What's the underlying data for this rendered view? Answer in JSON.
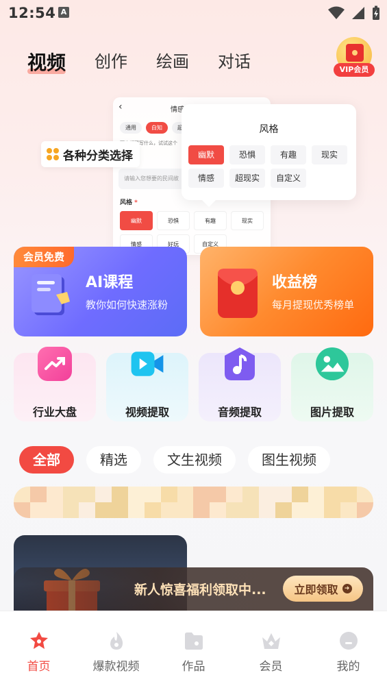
{
  "status_bar": {
    "time": "12:54",
    "notification_letter": "A"
  },
  "top_tabs": [
    {
      "label": "视频",
      "active": true
    },
    {
      "label": "创作",
      "active": false
    },
    {
      "label": "绘画",
      "active": false
    },
    {
      "label": "对话",
      "active": false
    }
  ],
  "vip_badge": {
    "label": "VIP会员"
  },
  "banner": {
    "float_label": "各种分类选择",
    "bg_card": {
      "title": "情感",
      "chips": [
        "通用",
        "白知",
        "超"
      ],
      "hint": "下次都要写什么，试试这个",
      "input_placeholder": "请输入您想要的民间故",
      "style_label": "风格",
      "style_required": "*",
      "tags_row1": [
        "幽默",
        "恐惧",
        "有趣",
        "现实"
      ],
      "tags_row2": [
        "情感",
        "好玩",
        "自定义"
      ]
    },
    "popover": {
      "title": "风格",
      "tags_row1": [
        "幽默",
        "恐惧",
        "有趣",
        "现实"
      ],
      "tags_row2": [
        "情感",
        "超现实",
        "自定义"
      ]
    }
  },
  "promo_cards": {
    "ai_course": {
      "badge": "会员免费",
      "title": "AI课程",
      "subtitle": "教你如何快速涨粉"
    },
    "earnings": {
      "title": "收益榜",
      "subtitle": "每月提现优秀榜单"
    }
  },
  "tools": [
    {
      "label": "行业大盘",
      "icon": "trend-chart-icon"
    },
    {
      "label": "视频提取",
      "icon": "video-camera-icon"
    },
    {
      "label": "音频提取",
      "icon": "music-note-icon"
    },
    {
      "label": "图片提取",
      "icon": "image-icon"
    }
  ],
  "categories": [
    {
      "label": "全部",
      "active": true
    },
    {
      "label": "精选",
      "active": false
    },
    {
      "label": "文生视频",
      "active": false
    },
    {
      "label": "图生视频",
      "active": false
    }
  ],
  "new_user_banner": {
    "text": "新人惊喜福利领取中...",
    "button_label": "立即领取",
    "button_icon": "arrow-right-circle-icon"
  },
  "bottom_nav": [
    {
      "label": "首页",
      "icon": "home-star-icon",
      "active": true
    },
    {
      "label": "爆款视频",
      "icon": "flame-icon",
      "active": false
    },
    {
      "label": "作品",
      "icon": "folder-icon",
      "active": false
    },
    {
      "label": "会员",
      "icon": "crown-icon",
      "active": false
    },
    {
      "label": "我的",
      "icon": "profile-icon",
      "active": false
    }
  ],
  "colors": {
    "accent_red": "#f24a42",
    "ai_purple": "#6f6cff",
    "earn_orange": "#ff8a2e",
    "gold": "#f5c585"
  }
}
